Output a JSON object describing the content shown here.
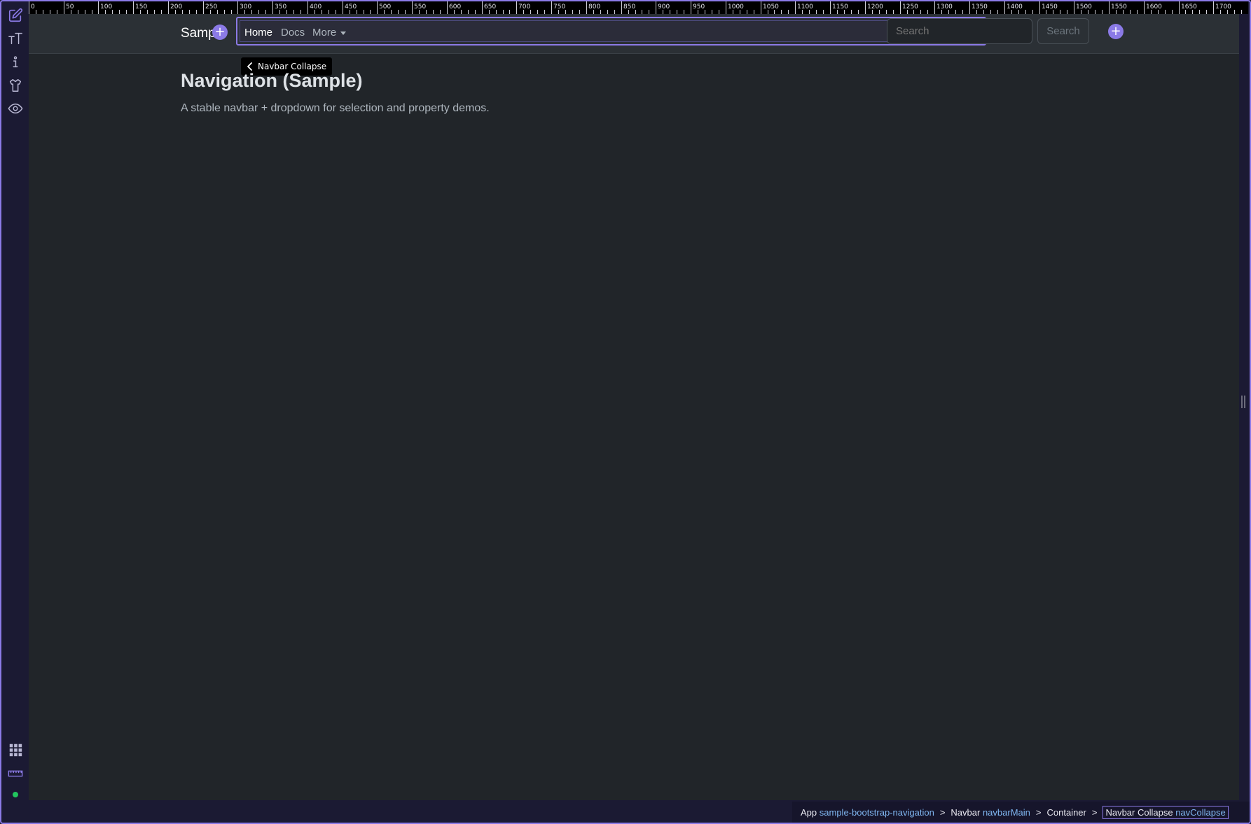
{
  "toolbar": {
    "tools": [
      {
        "name": "edit-icon"
      },
      {
        "name": "text-icon"
      },
      {
        "name": "info-icon"
      },
      {
        "name": "shirt-icon"
      },
      {
        "name": "eye-icon"
      }
    ],
    "bottom_tools": [
      {
        "name": "grid-icon"
      },
      {
        "name": "ruler-icon"
      }
    ],
    "status_color": "#22c55e"
  },
  "ruler": {
    "labels": [
      "0",
      "50",
      "100",
      "150",
      "200",
      "250",
      "300",
      "350",
      "400",
      "450",
      "500",
      "550",
      "600",
      "650",
      "700",
      "750",
      "800",
      "850",
      "900",
      "950",
      "1000",
      "1050",
      "1100",
      "1150",
      "1200",
      "1250",
      "1300",
      "1350",
      "1400",
      "1450",
      "1500",
      "1550",
      "1600",
      "1650",
      "1700"
    ]
  },
  "navbar": {
    "brand": "Samp",
    "links": [
      "Home",
      "Docs",
      "More"
    ],
    "search_placeholder": "Search",
    "search_button": "Search",
    "add_symbol": "+"
  },
  "tooltip": {
    "text": "Navbar Collapse"
  },
  "main": {
    "title": "Navigation (Sample)",
    "subtitle": "A stable navbar + dropdown for selection and property demos."
  },
  "breadcrumb": {
    "items": [
      {
        "type": "App",
        "id": "sample-bootstrap-navigation"
      },
      {
        "type": "Navbar",
        "id": "navbarMain"
      },
      {
        "type": "Container",
        "id": ""
      },
      {
        "type": "Navbar Collapse",
        "id": "navCollapse"
      }
    ],
    "separator": ">"
  },
  "colors": {
    "accent": "#8b7ae6",
    "canvas": "#212529",
    "navbar": "#2b3035",
    "chrome": "#1b1a33",
    "link_id": "#7fb6f0"
  }
}
